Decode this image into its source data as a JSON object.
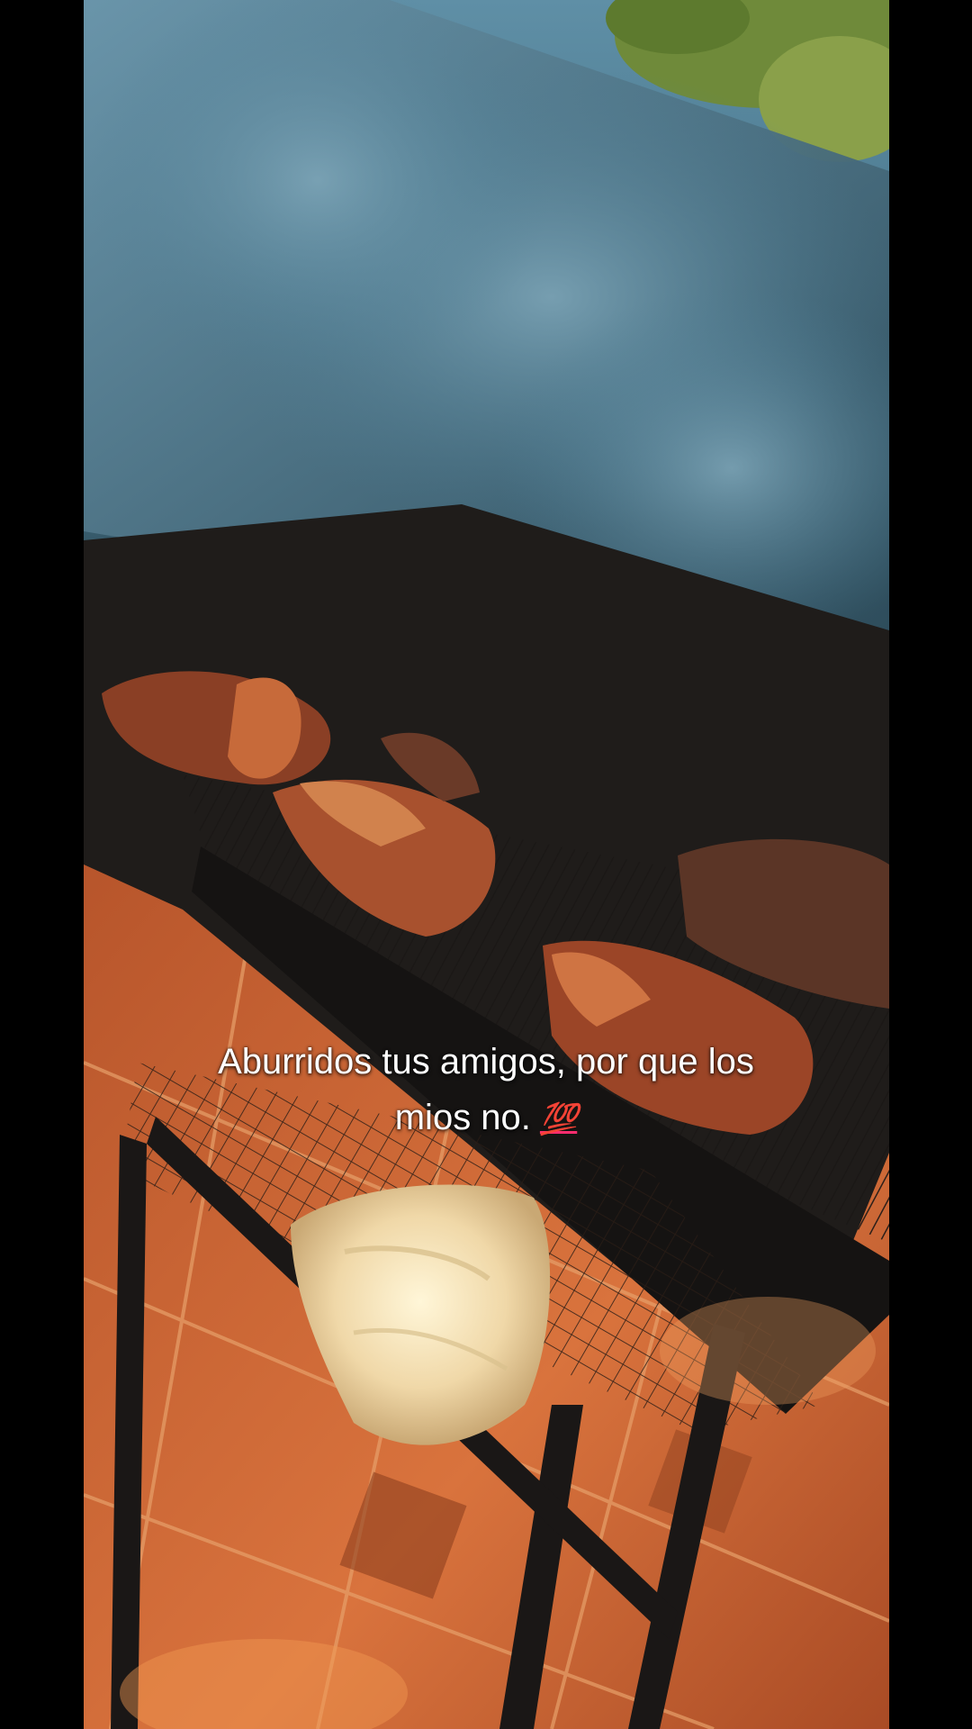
{
  "caption": {
    "line1": "Aburridos tus amigos, por que los",
    "line2": "mios no.",
    "emoji": "💯",
    "emoji_icon": "hundred-points-icon"
  },
  "colors": {
    "letterbox": "#000000",
    "smoke": "#4f7f96",
    "tile": "#c2602f",
    "meat": "#9a4a2c",
    "grill": "#1d1b1a",
    "caption_text": "#ffffff",
    "emoji": "#ff2d6f"
  }
}
